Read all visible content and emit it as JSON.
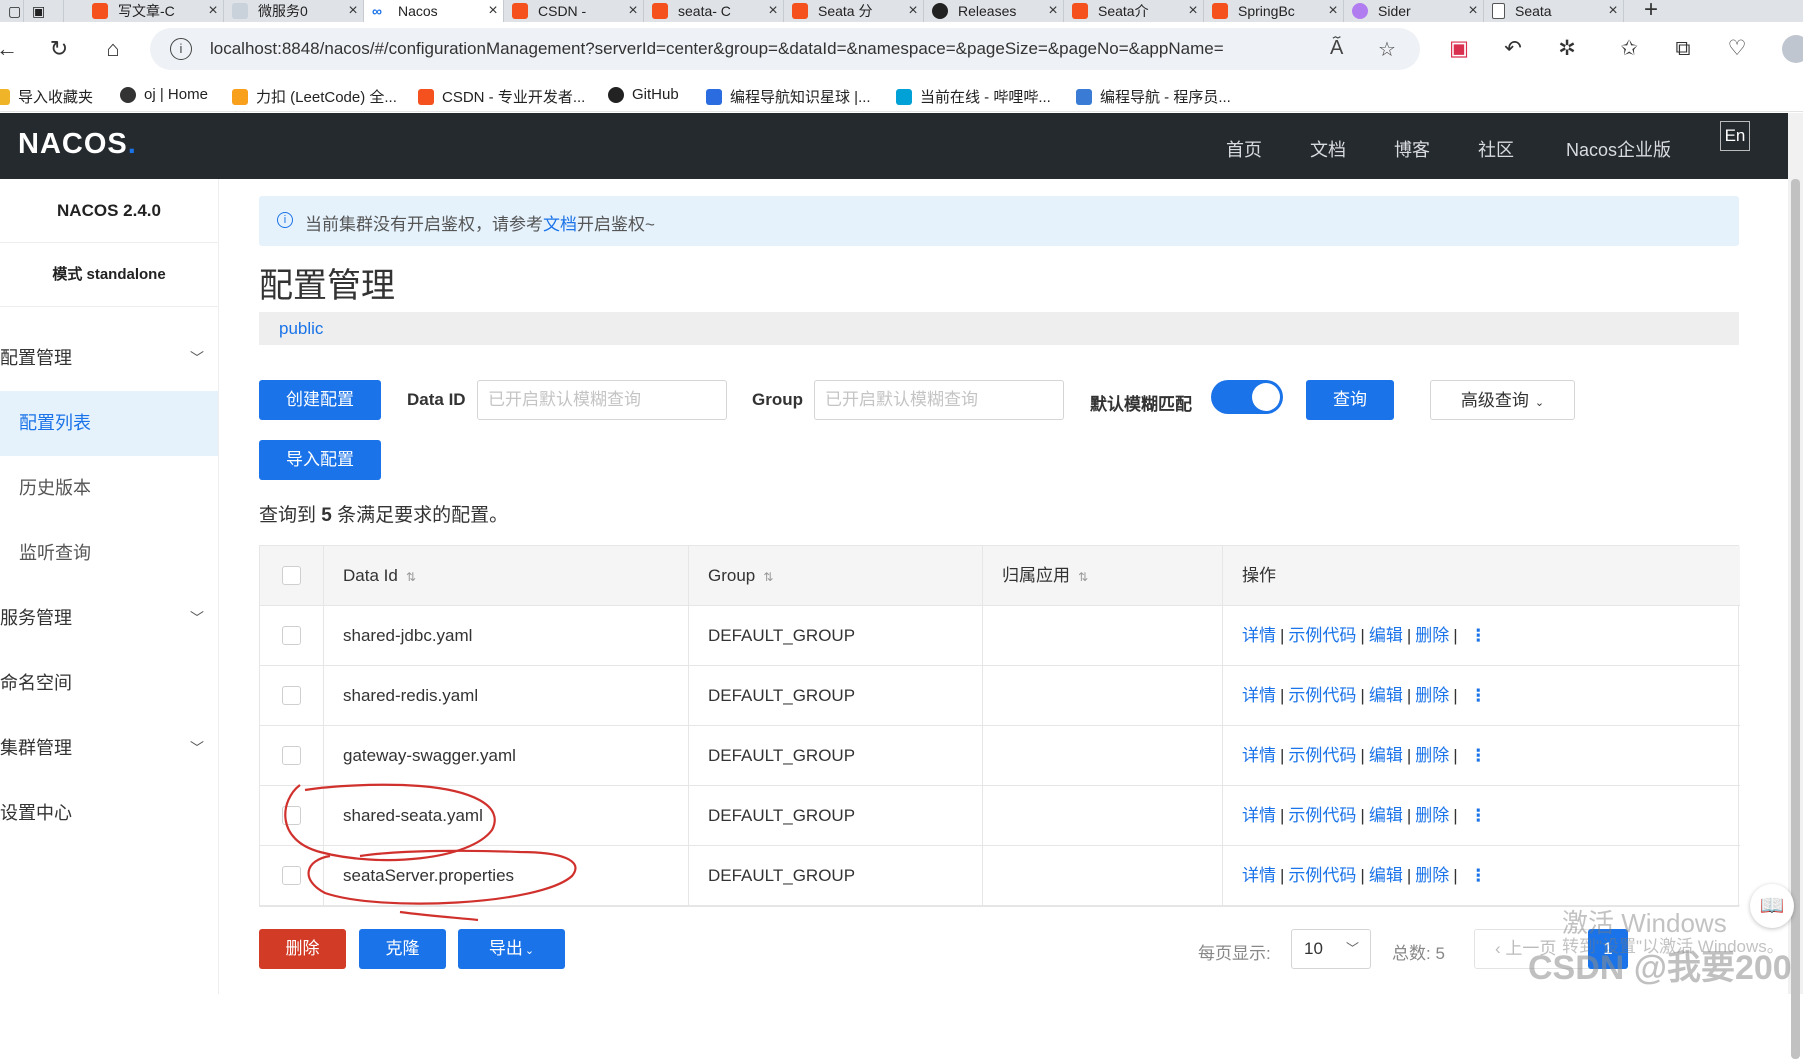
{
  "browser": {
    "tabs": [
      {
        "label": "写文章-C",
        "icon": "csdn-icon"
      },
      {
        "label": "微服务0",
        "icon": "page-icon"
      },
      {
        "label": "Nacos",
        "icon": "nacos-icon"
      },
      {
        "label": "CSDN - ",
        "icon": "csdn-icon"
      },
      {
        "label": "seata- C",
        "icon": "csdn-icon"
      },
      {
        "label": "Seata 分",
        "icon": "csdn-icon"
      },
      {
        "label": "Releases",
        "icon": "github-icon"
      },
      {
        "label": "Seata介",
        "icon": "csdn-icon"
      },
      {
        "label": "SpringBc",
        "icon": "csdn-icon"
      },
      {
        "label": "Sider",
        "icon": "sider-icon"
      },
      {
        "label": "Seata",
        "icon": "page-icon"
      }
    ],
    "url": "localhost:8848/nacos/#/configurationManagement?serverId=center&group=&dataId=&namespace=&pageSize=&pageNo=&appName=",
    "bookmarks": [
      {
        "label": "导入收藏夹"
      },
      {
        "label": "oj | Home"
      },
      {
        "label": "力扣 (LeetCode) 全..."
      },
      {
        "label": "CSDN - 专业开发者..."
      },
      {
        "label": "GitHub"
      },
      {
        "label": "编程导航知识星球 |..."
      },
      {
        "label": "当前在线 - 哔哩哔..."
      },
      {
        "label": "编程导航 - 程序员..."
      }
    ]
  },
  "header": {
    "logo": "NACOS",
    "nav": [
      "首页",
      "文档",
      "博客",
      "社区",
      "Nacos企业版"
    ],
    "lang": "En"
  },
  "sidebar": {
    "version": "NACOS 2.4.0",
    "mode": "模式 standalone",
    "items": [
      {
        "label": "配置管理",
        "expandable": true
      },
      {
        "label": "配置列表",
        "active": true
      },
      {
        "label": "历史版本"
      },
      {
        "label": "监听查询"
      },
      {
        "label": "服务管理",
        "expandable": true
      },
      {
        "label": "命名空间"
      },
      {
        "label": "集群管理",
        "expandable": true
      },
      {
        "label": "设置中心"
      }
    ]
  },
  "notice": {
    "prefix": "当前集群没有开启鉴权，请参考",
    "link": "文档",
    "suffix": "开启鉴权~"
  },
  "page": {
    "title": "配置管理",
    "namespace": "public"
  },
  "toolbar": {
    "create_label": "创建配置",
    "dataid_label": "Data ID",
    "dataid_placeholder": "已开启默认模糊查询",
    "group_label": "Group",
    "group_placeholder": "已开启默认模糊查询",
    "fuzzy_label": "默认模糊匹配",
    "fuzzy_on": true,
    "query_label": "查询",
    "advanced_label": "高级查询",
    "import_label": "导入配置"
  },
  "result": {
    "prefix": "查询到",
    "count": "5",
    "suffix": "条满足要求的配置。"
  },
  "table": {
    "headers": [
      "Data Id",
      "Group",
      "归属应用",
      "操作"
    ],
    "rows": [
      {
        "dataId": "shared-jdbc.yaml",
        "group": "DEFAULT_GROUP",
        "app": ""
      },
      {
        "dataId": "shared-redis.yaml",
        "group": "DEFAULT_GROUP",
        "app": ""
      },
      {
        "dataId": "gateway-swagger.yaml",
        "group": "DEFAULT_GROUP",
        "app": ""
      },
      {
        "dataId": "shared-seata.yaml",
        "group": "DEFAULT_GROUP",
        "app": ""
      },
      {
        "dataId": "seataServer.properties",
        "group": "DEFAULT_GROUP",
        "app": ""
      }
    ],
    "ops": {
      "detail": "详情",
      "sample": "示例代码",
      "edit": "编辑",
      "delete": "删除"
    }
  },
  "footer": {
    "delete_label": "删除",
    "clone_label": "克隆",
    "export_label": "导出",
    "page_size_label": "每页显示:",
    "page_size": "10",
    "total_label": "总数:",
    "total": "5",
    "prev_label": "上一页",
    "current_page": "1"
  },
  "watermarks": {
    "activate_title": "激活 Windows",
    "activate_sub": "转到\"设置\"以激活 Windows。",
    "csdn": "CSDN @我要200"
  },
  "colors": {
    "brand": "#1a73e8",
    "header_bg": "#252a2f",
    "danger": "#d23c26",
    "annotation": "#d0312d"
  }
}
